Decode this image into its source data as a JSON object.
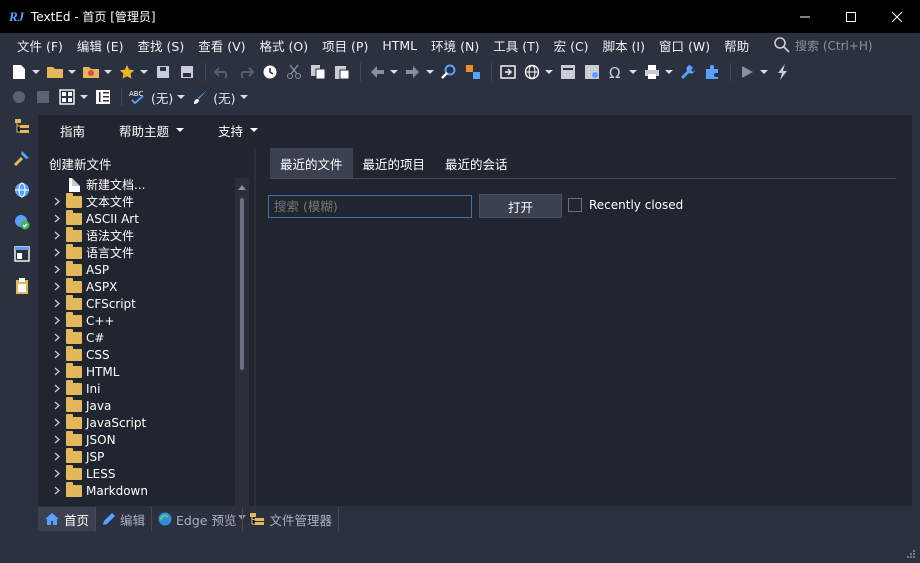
{
  "window": {
    "title": "TextEd - 首页 [管理员]",
    "logo": "RJ"
  },
  "menubar": {
    "items": [
      "文件 (F)",
      "编辑 (E)",
      "查找 (S)",
      "查看 (V)",
      "格式 (O)",
      "项目 (P)",
      "HTML",
      "环境 (N)",
      "工具 (T)",
      "宏 (C)",
      "脚本 (I)",
      "窗口 (W)",
      "帮助"
    ],
    "search_placeholder": "搜索 (Ctrl+H)"
  },
  "toolbar": {
    "spellcheck_value": "(无)",
    "brush_value": "(无)"
  },
  "home": {
    "menus": [
      "指南",
      "帮助主题",
      "支持"
    ],
    "new_file_title": "创建新文件",
    "new_document": "新建文档...",
    "file_types": [
      "文本文件",
      "ASCII Art",
      "语法文件",
      "语言文件",
      "ASP",
      "ASPX",
      "CFScript",
      "C++",
      "C#",
      "CSS",
      "HTML",
      "Ini",
      "Java",
      "JavaScript",
      "JSON",
      "JSP",
      "LESS",
      "Markdown"
    ],
    "tabs": [
      "最近的文件",
      "最近的项目",
      "最近的会话"
    ],
    "search_placeholder": "搜索 (模糊)",
    "open_label": "打开",
    "recently_closed_label": "Recently closed"
  },
  "bottom_tabs": [
    "首页",
    "编辑",
    "Edge 预览",
    "文件管理器"
  ],
  "colors": {
    "background": "#2c3140",
    "panel": "#21252f",
    "accent": "#3f6fb0",
    "folder": "#e3b75c"
  }
}
